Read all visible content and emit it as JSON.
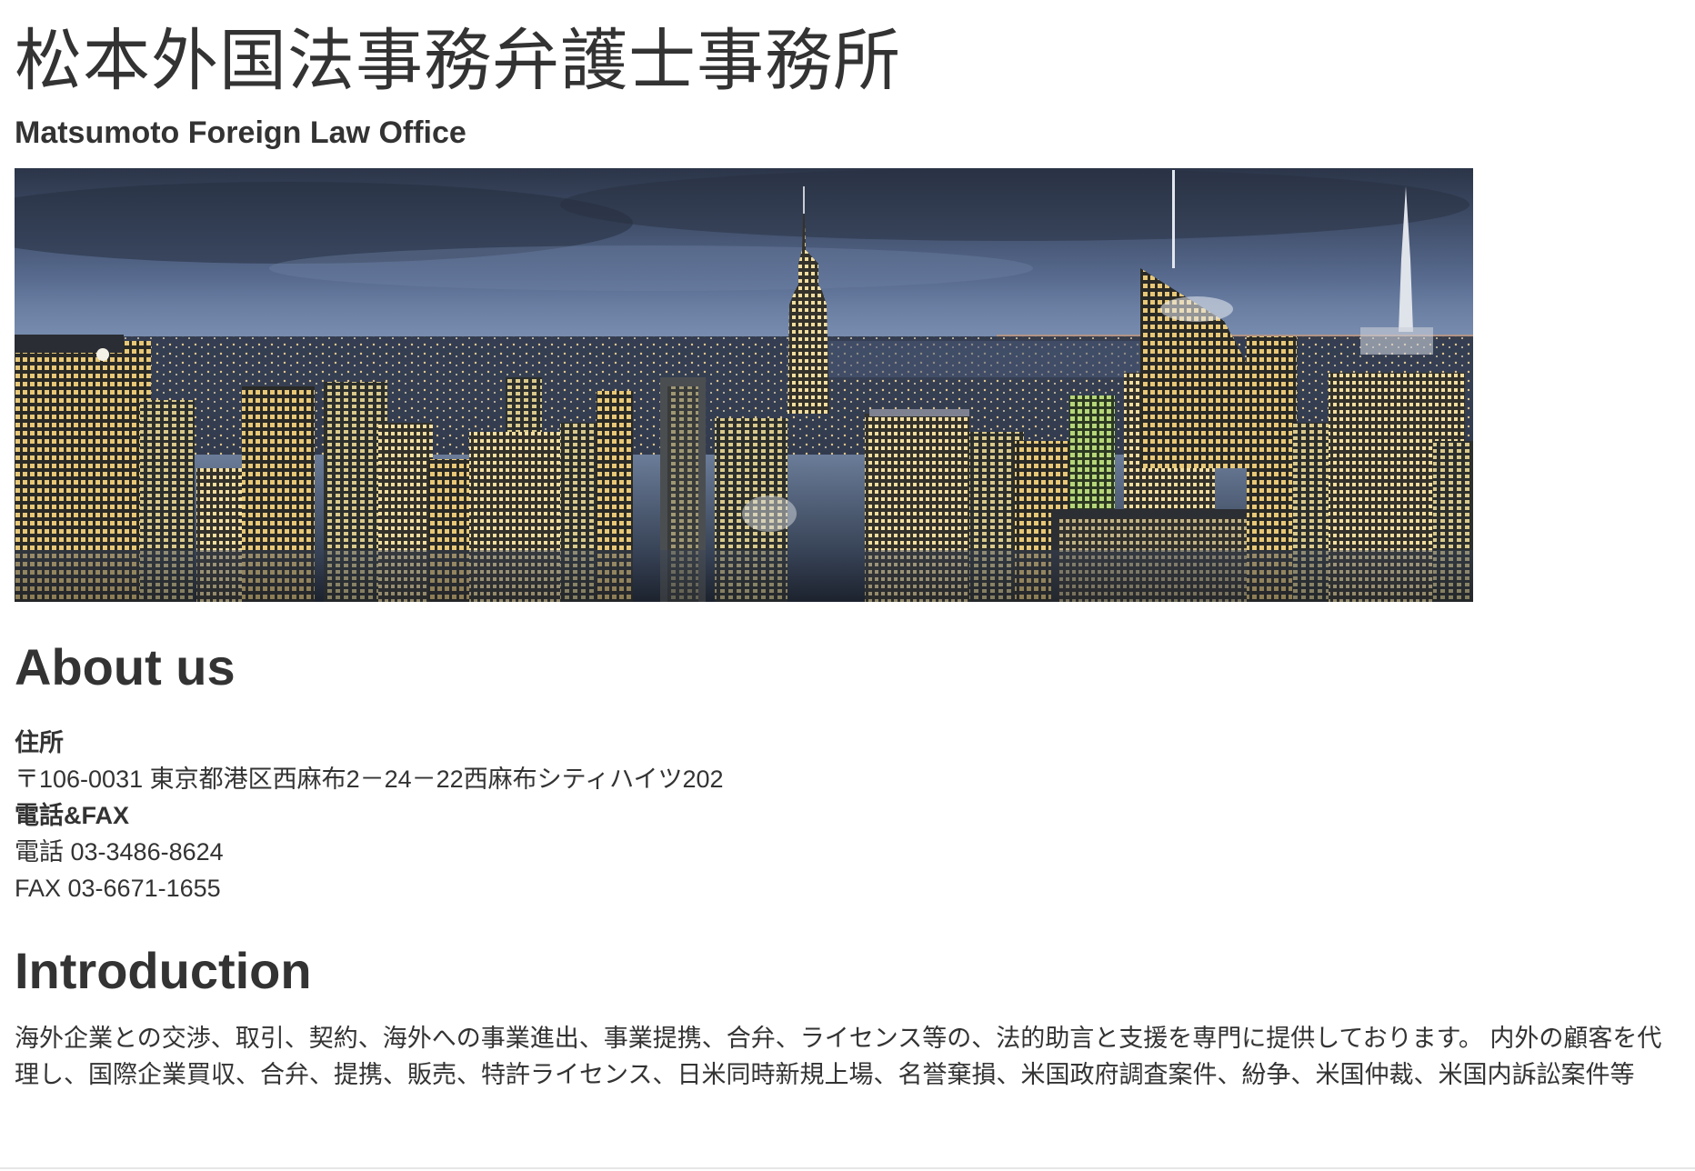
{
  "header": {
    "title": "松本外国法事務弁護士事務所",
    "subtitle": "Matsumoto Foreign Law Office"
  },
  "banner": {
    "description_icon": "city-skyline-image"
  },
  "about": {
    "heading": "About us",
    "address_label": "住所",
    "address_value": "〒106-0031 東京都港区西麻布2－24－22西麻布シティハイツ202",
    "contact_label": "電話&FAX",
    "phone": "電話 03-3486-8624",
    "fax": "FAX 03-6671-1655"
  },
  "introduction": {
    "heading": "Introduction",
    "body": "海外企業との交渉、取引、契約、海外への事業進出、事業提携、合弁、ライセンス等の、法的助言と支援を専門に提供しております。 内外の顧客を代理し、国際企業買収、合弁、提携、販売、特許ライセンス、日米同時新規上場、名誉棄損、米国政府調査案件、紛争、米国仲裁、米国内訴訟案件等"
  }
}
